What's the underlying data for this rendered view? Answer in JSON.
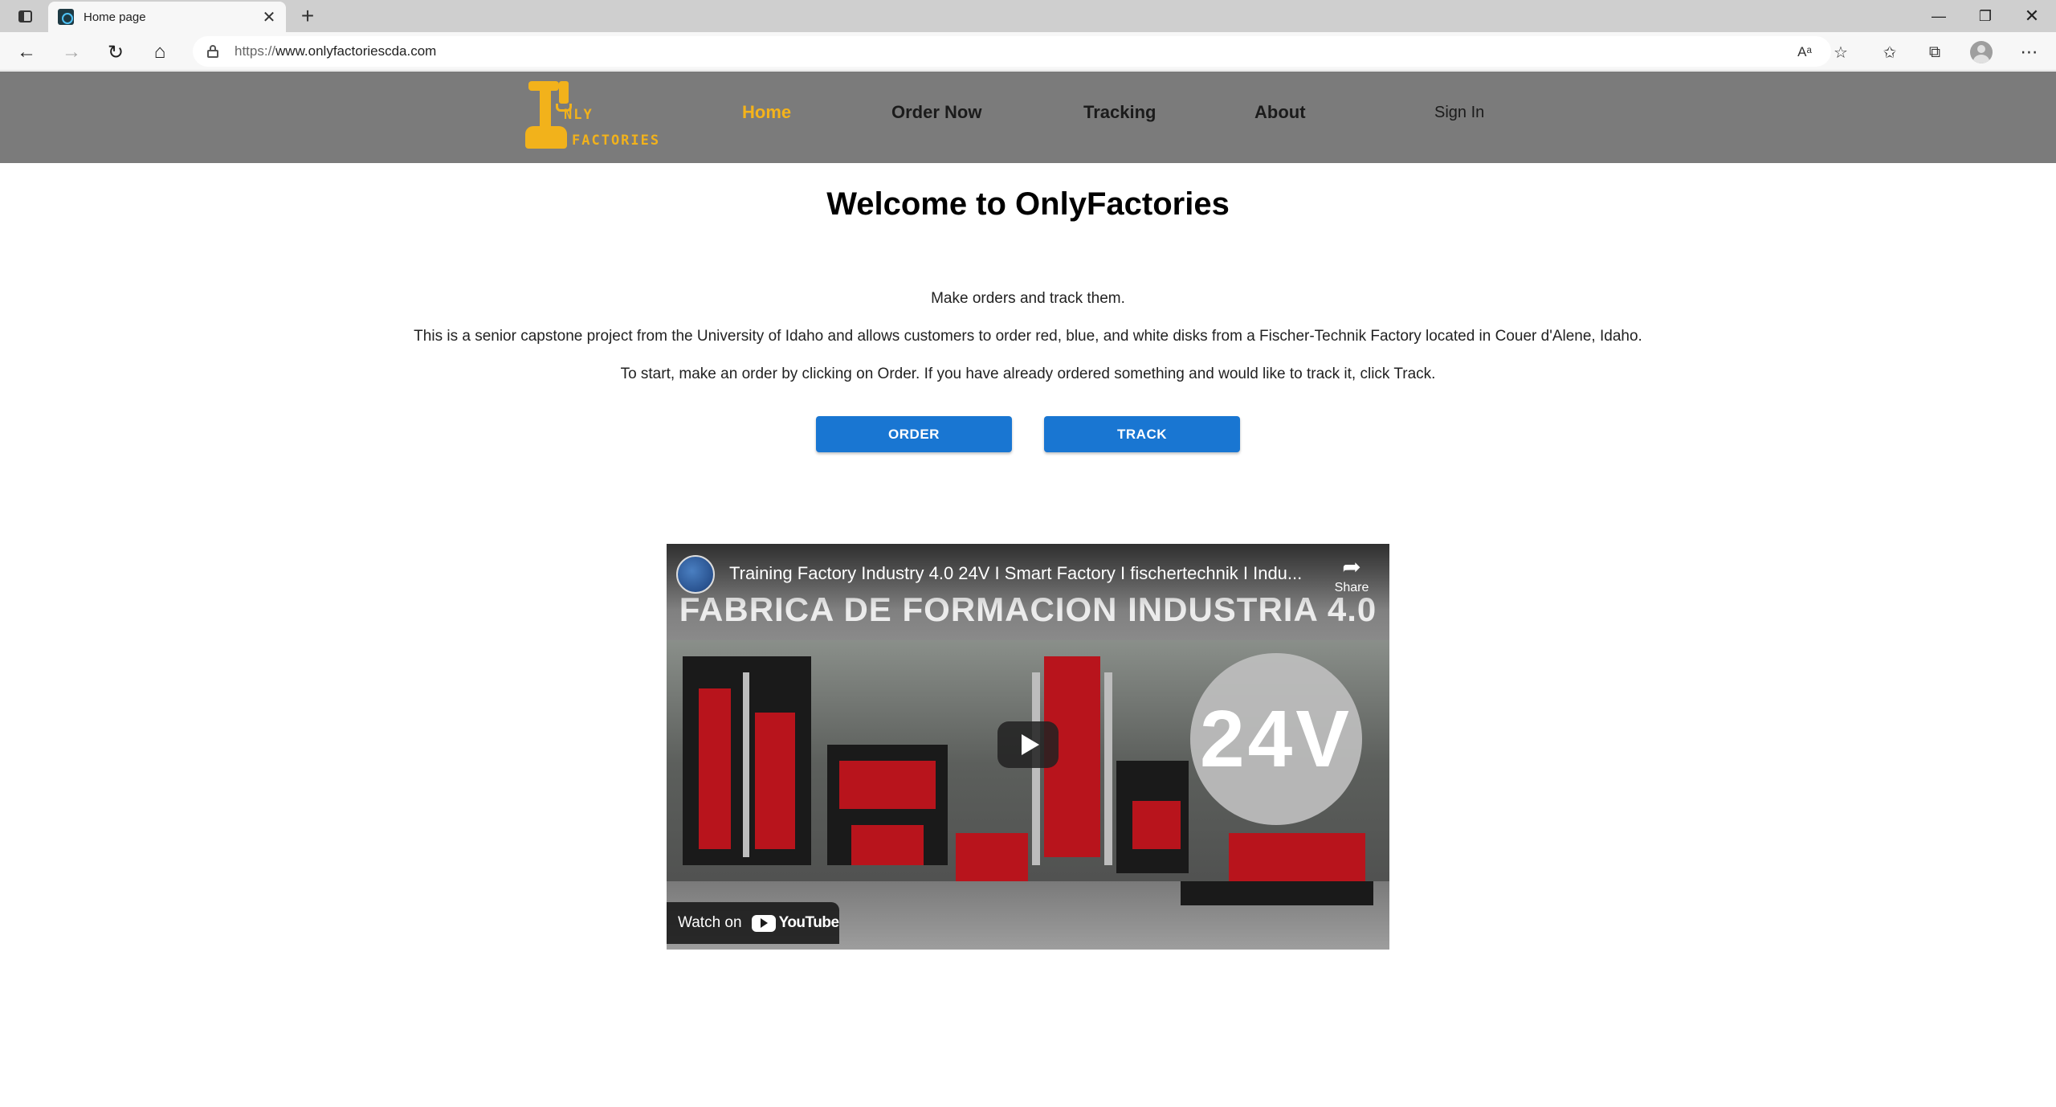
{
  "browser": {
    "tab_title": "Home page",
    "tab_close": "✕",
    "new_tab": "+",
    "url_protocol": "https://",
    "url_host": "www.onlyfactoriescda.com",
    "win_min": "—",
    "win_max": "❐",
    "win_close": "✕"
  },
  "nav": {
    "logo_line1": "NLY",
    "logo_line2": "FACTORIES",
    "home": "Home",
    "order_now": "Order Now",
    "tracking": "Tracking",
    "about": "About",
    "sign_in": "Sign In",
    "active_color": "#f5b31a"
  },
  "main": {
    "title": "Welcome to OnlyFactories",
    "para1": "Make orders and track them.",
    "para2": "This is a senior capstone project from the University of Idaho and allows customers to order red, blue, and white disks from a Fischer-Technik Factory located in Couer d'Alene, Idaho.",
    "para3": "To start, make an order by clicking on Order. If you have already ordered something and would like to track it, click Track.",
    "order_button": "ORDER",
    "track_button": "TRACK",
    "button_color": "#1976d2"
  },
  "video": {
    "title": "Training Factory Industry 4.0 24V I Smart Factory I fischertechnik I Indu...",
    "banner_text": "FABRICA DE FORMACION INDUSTRIA 4.0",
    "badge_text": "24V",
    "share_label": "Share",
    "watch_on": "Watch on",
    "youtube_word": "YouTube"
  }
}
